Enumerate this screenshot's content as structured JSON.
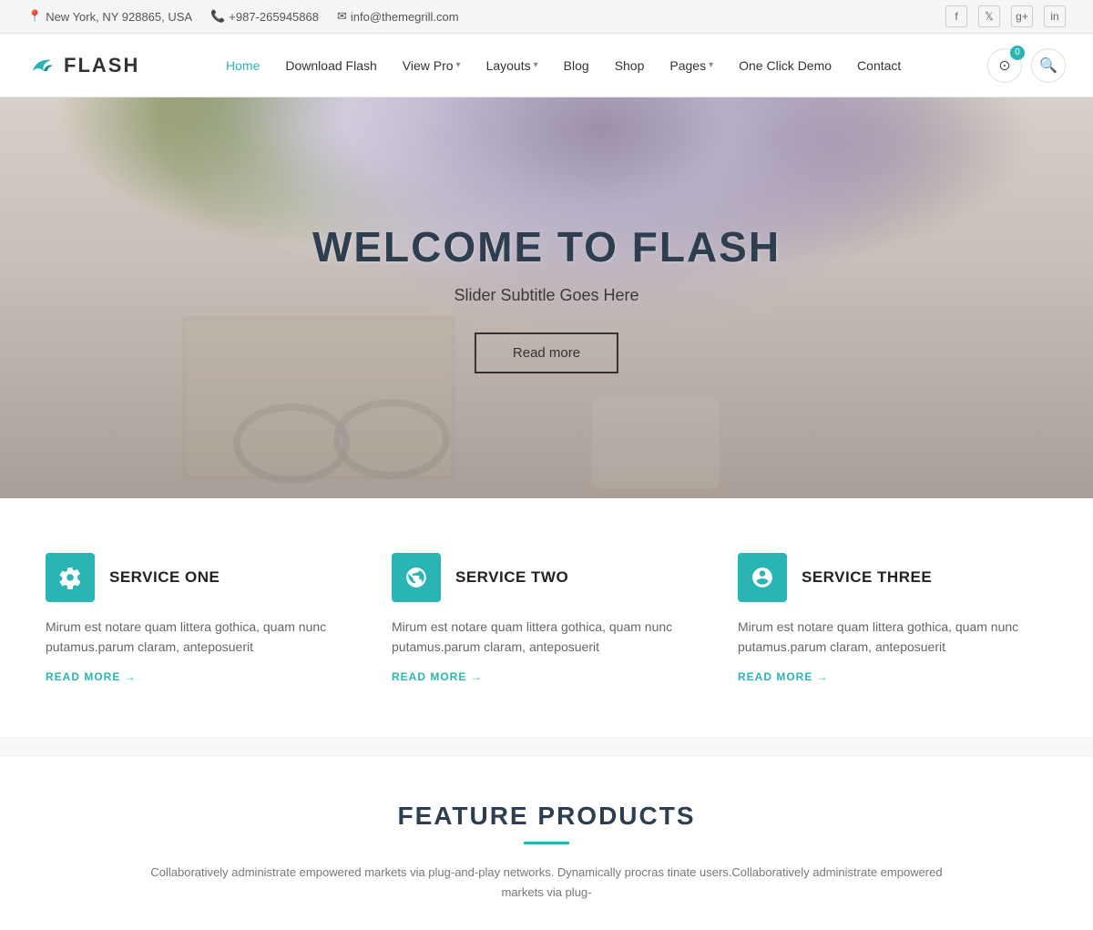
{
  "topbar": {
    "location_icon": "📍",
    "location": "New York, NY 928865, USA",
    "phone_icon": "📞",
    "phone": "+987-265945868",
    "email_icon": "✉",
    "email": "info@themegrill.com"
  },
  "social": {
    "facebook": "f",
    "twitter": "t",
    "google_plus": "g+",
    "linkedin": "in"
  },
  "header": {
    "logo_text": "FLASH",
    "cart_count": "0",
    "nav_items": [
      {
        "label": "Home",
        "active": true,
        "has_dropdown": false
      },
      {
        "label": "Download Flash",
        "active": false,
        "has_dropdown": false
      },
      {
        "label": "View Pro",
        "active": false,
        "has_dropdown": true
      },
      {
        "label": "Layouts",
        "active": false,
        "has_dropdown": true
      },
      {
        "label": "Blog",
        "active": false,
        "has_dropdown": false
      },
      {
        "label": "Shop",
        "active": false,
        "has_dropdown": false
      },
      {
        "label": "Pages",
        "active": false,
        "has_dropdown": true
      },
      {
        "label": "One Click Demo",
        "active": false,
        "has_dropdown": false
      },
      {
        "label": "Contact",
        "active": false,
        "has_dropdown": false
      }
    ]
  },
  "hero": {
    "title": "WELCOME TO FLASH",
    "subtitle": "Slider Subtitle Goes Here",
    "button_label": "Read more"
  },
  "services": [
    {
      "icon": "⚙",
      "title": "SERVICE ONE",
      "description": "Mirum est notare quam littera gothica, quam nunc putamus.parum claram, anteposuerit",
      "link": "READ MORE →"
    },
    {
      "icon": "⊕",
      "title": "SERVICE TWO",
      "description": "Mirum est notare quam littera gothica, quam nunc putamus.parum claram, anteposuerit",
      "link": "READ MORE →"
    },
    {
      "icon": "◎",
      "title": "SERVICE THREE",
      "description": "Mirum est notare quam littera gothica, quam nunc putamus.parum claram, anteposuerit",
      "link": "READ MORE →"
    }
  ],
  "feature_products": {
    "title": "FEATURE PRODUCTS",
    "description": "Collaboratively administrate empowered markets via plug-and-play networks. Dynamically procras tinate users.Collaboratively administrate empowered markets via plug-"
  }
}
